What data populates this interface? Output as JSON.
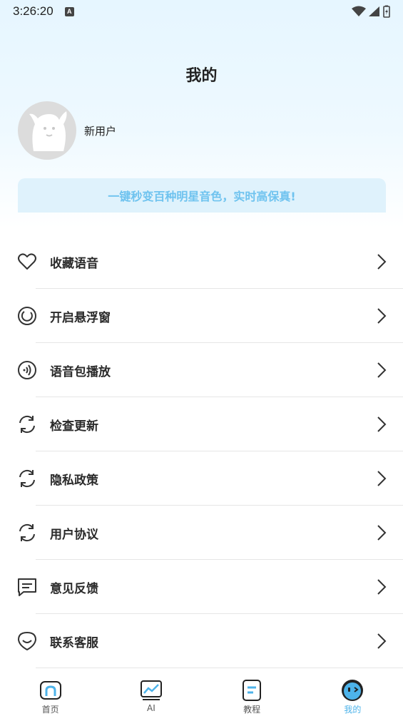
{
  "status_bar": {
    "time": "3:26:20",
    "badge": "A"
  },
  "header": {
    "title": "我的"
  },
  "profile": {
    "username": "新用户"
  },
  "banner": {
    "text": "一键秒变百种明星音色，实时高保真!"
  },
  "menu": {
    "items": [
      {
        "label": "收藏语音",
        "icon": "heart-icon"
      },
      {
        "label": "开启悬浮窗",
        "icon": "float-window-icon"
      },
      {
        "label": "语音包播放",
        "icon": "audio-play-icon"
      },
      {
        "label": "检查更新",
        "icon": "refresh-icon"
      },
      {
        "label": "隐私政策",
        "icon": "refresh-icon"
      },
      {
        "label": "用户协议",
        "icon": "refresh-icon"
      },
      {
        "label": "意见反馈",
        "icon": "message-icon"
      },
      {
        "label": "联系客服",
        "icon": "smile-icon"
      }
    ]
  },
  "tabbar": {
    "tabs": [
      {
        "label": "首页",
        "icon": "home-icon"
      },
      {
        "label": "AI",
        "icon": "ai-chart-icon"
      },
      {
        "label": "教程",
        "icon": "tutorial-icon"
      },
      {
        "label": "我的",
        "icon": "mine-face-icon"
      }
    ],
    "active_index": 3
  },
  "colors": {
    "accent": "#4db3ea",
    "banner_text": "#6fc3ef",
    "banner_bg": "#dff2fc"
  }
}
